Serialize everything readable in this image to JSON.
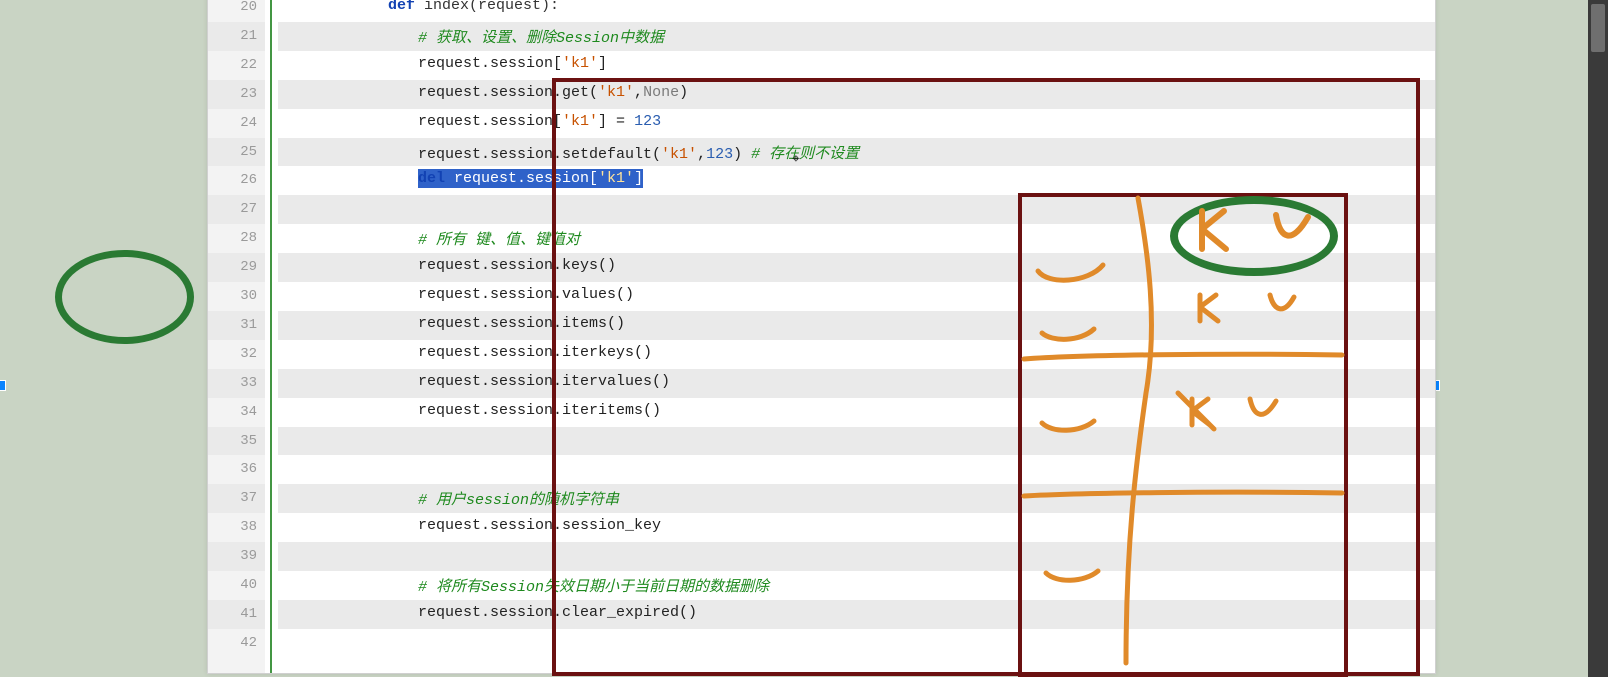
{
  "lines": [
    {
      "n": 20,
      "indent": 3
    },
    {
      "n": 21,
      "indent": 4
    },
    {
      "n": 22,
      "indent": 4
    },
    {
      "n": 23,
      "indent": 4
    },
    {
      "n": 24,
      "indent": 4
    },
    {
      "n": 25,
      "indent": 4
    },
    {
      "n": 26,
      "indent": 4
    },
    {
      "n": 27,
      "indent": 0
    },
    {
      "n": 28,
      "indent": 4
    },
    {
      "n": 29,
      "indent": 4
    },
    {
      "n": 30,
      "indent": 4
    },
    {
      "n": 31,
      "indent": 4
    },
    {
      "n": 32,
      "indent": 4
    },
    {
      "n": 33,
      "indent": 4
    },
    {
      "n": 34,
      "indent": 4
    },
    {
      "n": 35,
      "indent": 0
    },
    {
      "n": 36,
      "indent": 0
    },
    {
      "n": 37,
      "indent": 4
    },
    {
      "n": 38,
      "indent": 4
    },
    {
      "n": 39,
      "indent": 0
    },
    {
      "n": 40,
      "indent": 4
    },
    {
      "n": 41,
      "indent": 4
    },
    {
      "n": 42,
      "indent": 0
    }
  ],
  "code": {
    "l20_def": "def",
    "l20_name": " index(request):",
    "l21": "# 获取、设置、删除Session中数据",
    "l22_a": "request.session[",
    "l22_b": "'k1'",
    "l22_c": "]",
    "l23_a": "request.session.get(",
    "l23_b": "'k1'",
    "l23_c": ",",
    "l23_d": "None",
    "l23_e": ")",
    "l24_a": "request.session[",
    "l24_b": "'k1'",
    "l24_c": "] = ",
    "l24_d": "123",
    "l25_a": "request.session.setdefault(",
    "l25_b": "'k1'",
    "l25_c": ",",
    "l25_d": "123",
    "l25_e": ") ",
    "l25_f": "# 存在则不设置",
    "l26_a": "del",
    "l26_b": " request.session[",
    "l26_c": "'k1'",
    "l26_d": "]",
    "l28": "# 所有 键、值、键值对",
    "l29": "request.session.keys()",
    "l30": "request.session.values()",
    "l31": "request.session.items()",
    "l32": "request.session.iterkeys()",
    "l33": "request.session.itervalues()",
    "l34": "request.session.iteritems()",
    "l37": "# 用户session的随机字符串",
    "l38": "request.session.session_key",
    "l40": "# 将所有Session失效日期小于当前日期的数据删除",
    "l41": "request.session.clear_expired()"
  },
  "drawn": {
    "k": "k",
    "v": "v"
  }
}
